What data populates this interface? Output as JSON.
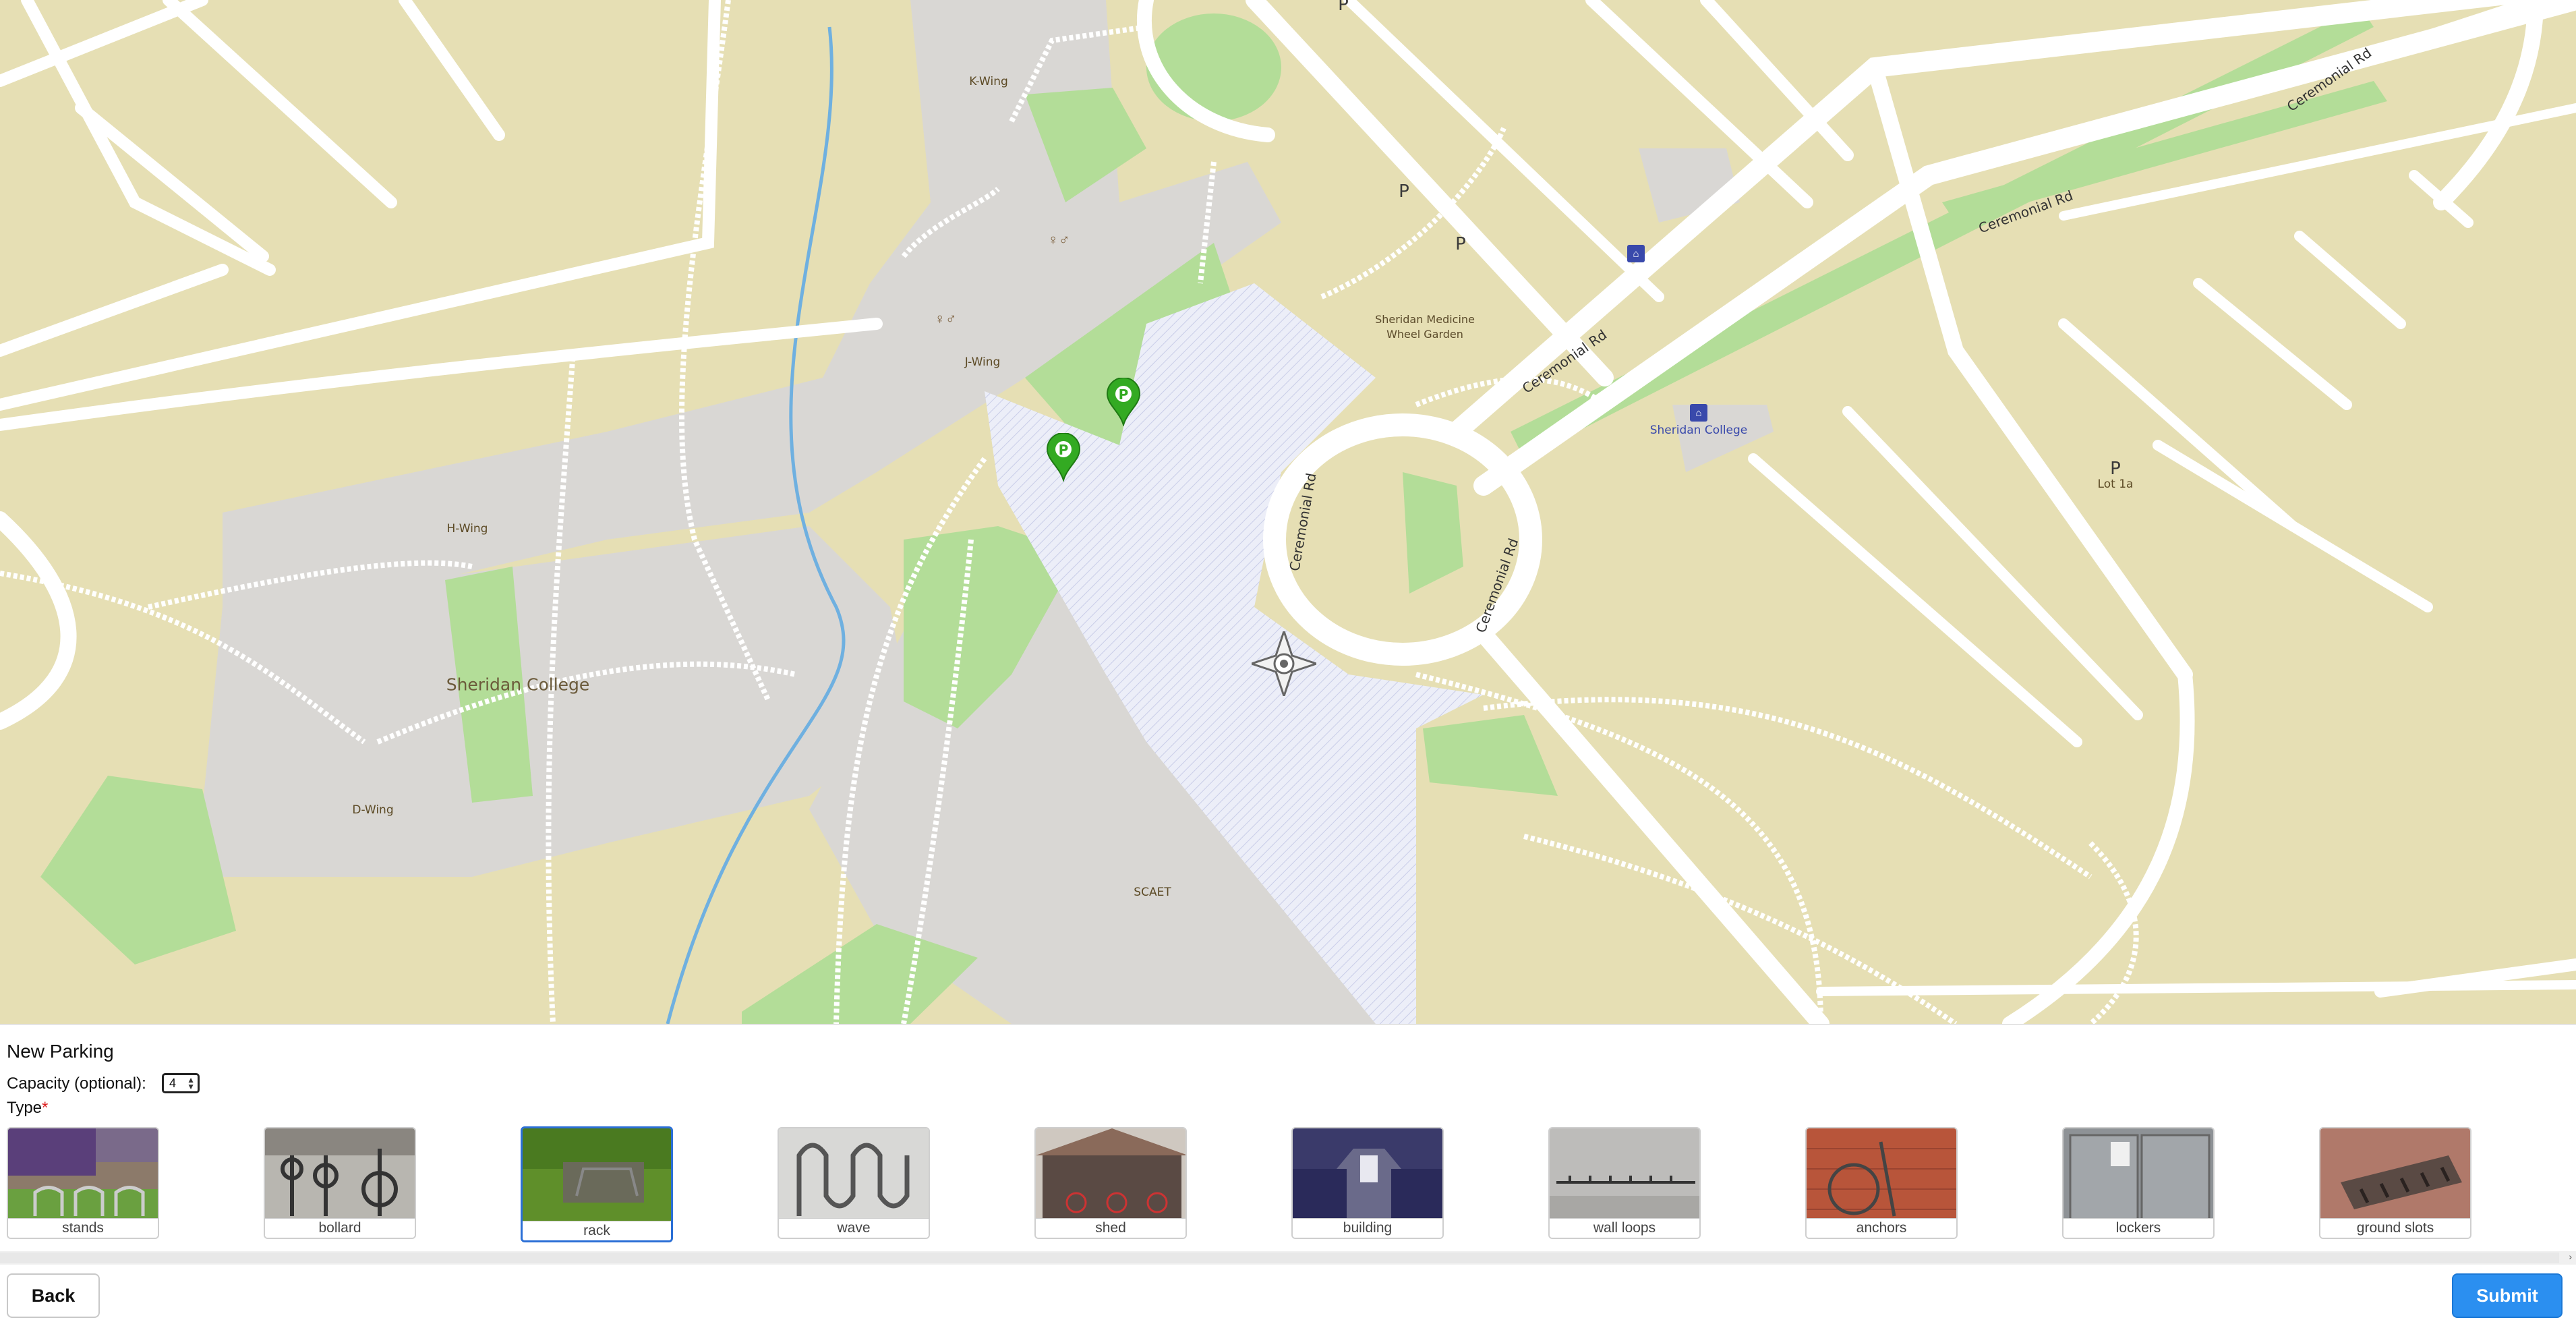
{
  "map": {
    "labels": {
      "k_wing": "K-Wing",
      "j_wing": "J-Wing",
      "h_wing": "H-Wing",
      "d_wing": "D-Wing",
      "scaet": "SCAET",
      "campus": "Sheridan College",
      "garden": "Sheridan Medicine Wheel Garden",
      "bus_stop": "Sheridan College",
      "lot": "Lot 1a",
      "parking_p": "P",
      "road_1": "Ceremonial Rd",
      "road_2": "Ceremonial Rd",
      "road_3": "Ceremonial Rd",
      "road_4": "Ceremonial Rd",
      "road_5": "Ceremonial Rd"
    },
    "markers": [
      {
        "label": "P",
        "color": "#33aa22"
      },
      {
        "label": "P",
        "color": "#33aa22"
      }
    ]
  },
  "form": {
    "title": "New Parking",
    "capacity_label": "Capacity (optional):",
    "capacity_value": "4",
    "type_label": "Type",
    "required_mark": "*",
    "types": [
      {
        "label": "stands",
        "selected": false
      },
      {
        "label": "bollard",
        "selected": false
      },
      {
        "label": "rack",
        "selected": true
      },
      {
        "label": "wave",
        "selected": false
      },
      {
        "label": "shed",
        "selected": false
      },
      {
        "label": "building",
        "selected": false
      },
      {
        "label": "wall loops",
        "selected": false
      },
      {
        "label": "anchors",
        "selected": false
      },
      {
        "label": "lockers",
        "selected": false
      },
      {
        "label": "ground slots",
        "selected": false
      }
    ]
  },
  "buttons": {
    "back": "Back",
    "submit": "Submit"
  },
  "colors": {
    "land": "#e6dfb4",
    "road": "#ffffff",
    "building_area": "#d9d7d4",
    "grass": "#b3dd98",
    "plaza": "#e6e6f4",
    "water": "#6fb0e0",
    "accent": "#2b8ff0",
    "selected_border": "#2b6fd6"
  }
}
